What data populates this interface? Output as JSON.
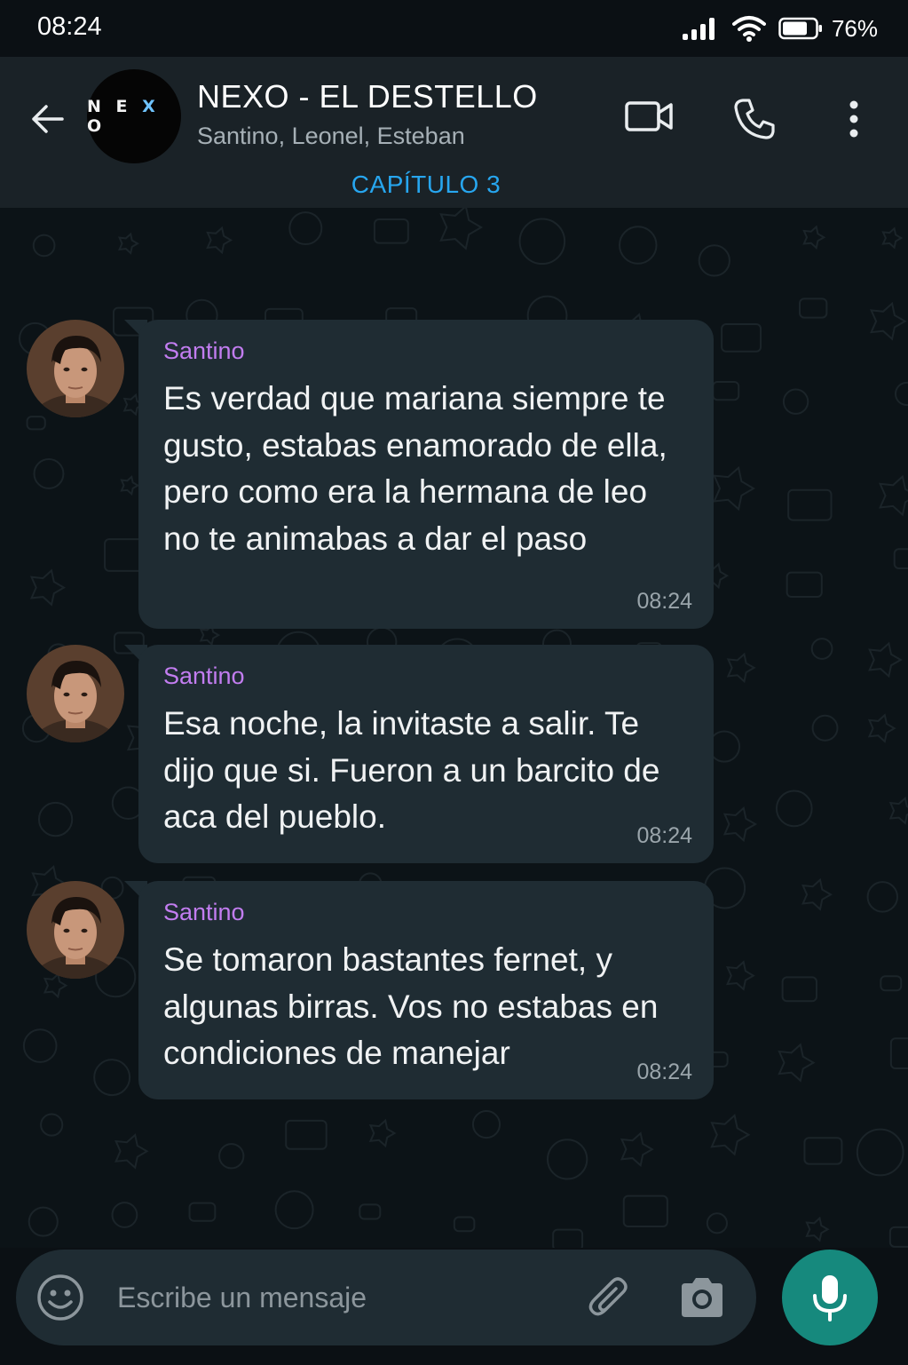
{
  "status_bar": {
    "time": "08:24",
    "battery_percent": "76%",
    "battery_level": 0.76
  },
  "header": {
    "back_icon": "arrow-left-icon",
    "group_logo": "NEXO",
    "group_title": "NEXO - EL DESTELLO",
    "members": "Santino, Leonel, Esteban",
    "chapter": "CAPÍTULO 3",
    "actions": [
      "video-call-icon",
      "phone-icon",
      "more-vert-icon"
    ]
  },
  "messages": [
    {
      "sender": "Santino",
      "text": "Es verdad que mariana siempre te gusto, estabas enamorado de ella, pero como era la hermana de leo no te animabas a dar el paso",
      "time": "08:24"
    },
    {
      "sender": "Santino",
      "text": "Esa noche, la invitaste a salir. Te dijo que si. Fueron a un barcito de aca del pueblo.",
      "time": "08:24"
    },
    {
      "sender": "Santino",
      "text": "Se tomaron bastantes fernet, y algunas birras. Vos no estabas en condiciones de manejar",
      "time": "08:24"
    }
  ],
  "composer": {
    "placeholder": "Escribe un mensaje",
    "icons": [
      "emoji-icon",
      "paperclip-icon",
      "camera-icon",
      "microphone-icon"
    ]
  },
  "colors": {
    "header_bg": "#1a2227",
    "chat_bg": "#0c1317",
    "bubble_bg": "#1f2c33",
    "sender_name": "#c27df0",
    "chapter_accent": "#27a6ef",
    "mic_button": "#16897d"
  }
}
